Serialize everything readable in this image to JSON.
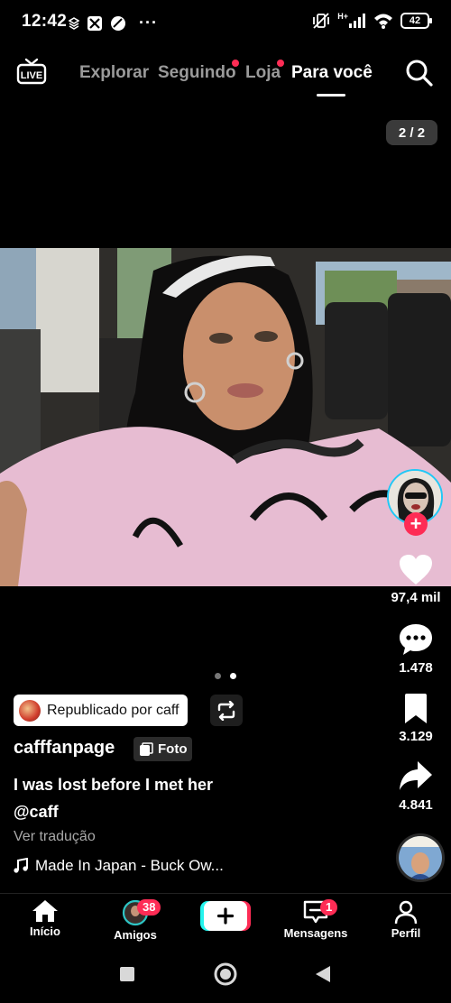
{
  "status_bar": {
    "time": "12:42",
    "network": "H+",
    "battery": "42"
  },
  "top_nav": {
    "live_label": "LIVE",
    "tabs": [
      {
        "label": "Explorar",
        "active": false,
        "dot": false
      },
      {
        "label": "Seguindo",
        "active": false,
        "dot": true
      },
      {
        "label": "Loja",
        "active": false,
        "dot": true
      },
      {
        "label": "Para você",
        "active": true,
        "dot": false
      }
    ]
  },
  "post": {
    "page_counter": "2 / 2",
    "carousel": {
      "total": 2,
      "current": 2
    },
    "repost_label": "Republicado por caff",
    "username": "cafffanpage",
    "type_badge": "Foto",
    "caption_line1": "I was lost before I met her",
    "caption_mention": "@caff",
    "translate_label": "Ver tradução",
    "music": "Made In Japan - Buck Ow..."
  },
  "actions": {
    "likes": "97,4 mil",
    "comments": "1.478",
    "saves": "3.129",
    "shares": "4.841"
  },
  "bottom_nav": {
    "home": "Início",
    "friends": "Amigos",
    "friends_badge": "38",
    "inbox": "Mensagens",
    "inbox_badge": "1",
    "profile": "Perfil"
  },
  "colors": {
    "accent": "#fe2c55",
    "cyan": "#25f4ee",
    "background": "#000000"
  }
}
